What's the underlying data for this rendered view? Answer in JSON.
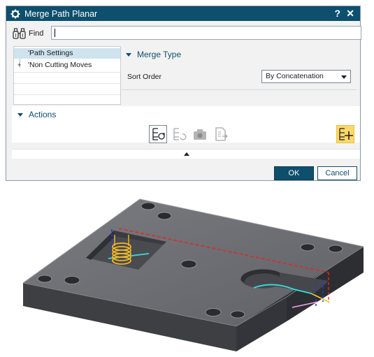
{
  "dialog": {
    "title": "Merge Path Planar",
    "help_glyph": "?",
    "close_glyph": "✕"
  },
  "find": {
    "label": "Find",
    "value": ""
  },
  "tree": {
    "items": [
      {
        "label": "'Path Settings",
        "selected": true
      },
      {
        "label": "'Non Cutting Moves",
        "expander": "+"
      }
    ]
  },
  "merge_type": {
    "title": "Merge Type",
    "sort_order_label": "Sort Order",
    "sort_order_value": "By Concatenation"
  },
  "actions": {
    "title": "Actions",
    "buttons": [
      {
        "name": "merge-refresh-icon",
        "enabled": true
      },
      {
        "name": "merge-reverse-icon",
        "enabled": false
      },
      {
        "name": "camera-icon",
        "enabled": false
      },
      {
        "name": "document-export-icon",
        "enabled": false
      },
      {
        "name": "merge-add-icon",
        "enabled": true,
        "highlighted": true
      }
    ]
  },
  "buttons": {
    "ok_label": "OK",
    "cancel_label": "Cancel"
  },
  "colors": {
    "titlebar": "#0d4f6c",
    "accent": "#0d4f6c",
    "highlight": "#fcd868"
  }
}
